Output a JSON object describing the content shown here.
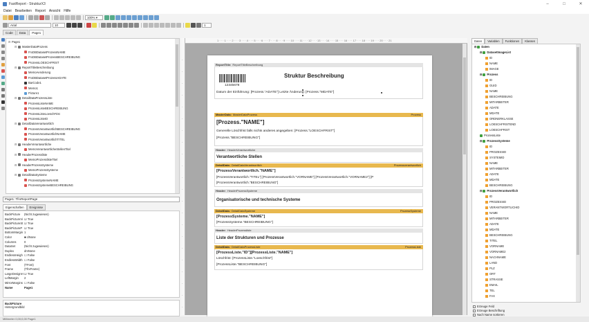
{
  "window": {
    "title": "FastReport - StrukturX3",
    "controls": [
      "–",
      "□",
      "✕"
    ]
  },
  "menu": [
    "Datei",
    "Bearbeiten",
    "Report",
    "Ansicht",
    "Hilfe"
  ],
  "toolbar": {
    "zoom": "100% ▾",
    "font_name": "Arial",
    "font_size": "10",
    "extra": "1"
  },
  "tabs": [
    "Code",
    "Data",
    "Page1"
  ],
  "tree": [
    {
      "t": "Page1",
      "lvl": 0,
      "ic": "page",
      "exp": "⊟"
    },
    {
      "t": "MasterDataProzess",
      "lvl": 1,
      "ic": "band",
      "exp": "⊟"
    },
    {
      "t": "FrxDBDatasetProzessNAME",
      "lvl": 2,
      "ic": "memo"
    },
    {
      "t": "FrxDBDatasetProzessBESCHREIBUNG",
      "lvl": 2,
      "ic": "memo"
    },
    {
      "t": "ProzessLOESCHFRIST",
      "lvl": 2,
      "ic": "memo"
    },
    {
      "t": "ReportTitleBeschreibung",
      "lvl": 1,
      "ic": "band",
      "exp": "⊟"
    },
    {
      "t": "MemoAenderung",
      "lvl": 2,
      "ic": "memo"
    },
    {
      "t": "FrxDBDatasetProzessADATE",
      "lvl": 2,
      "ic": "memo"
    },
    {
      "t": "BarCode1",
      "lvl": 2,
      "ic": "bar"
    },
    {
      "t": "Memo1",
      "lvl": 2,
      "ic": "memo"
    },
    {
      "t": "Picture1",
      "lvl": 2,
      "ic": "pic"
    },
    {
      "t": "DetailDataProzessListe",
      "lvl": 1,
      "ic": "band",
      "exp": "⊟"
    },
    {
      "t": "ProzessListeNAME",
      "lvl": 2,
      "ic": "memo"
    },
    {
      "t": "ProzessListeBESCHREIBUNG",
      "lvl": 2,
      "ic": "memo"
    },
    {
      "t": "ProzessListeLoeschFrist",
      "lvl": 2,
      "ic": "memo"
    },
    {
      "t": "ProzessListeID",
      "lvl": 2,
      "ic": "memo"
    },
    {
      "t": "DetailDataVerantwortlich",
      "lvl": 1,
      "ic": "band",
      "exp": "⊟"
    },
    {
      "t": "ProzessVerantwortlichBESCHREIBUNG",
      "lvl": 2,
      "ic": "memo"
    },
    {
      "t": "ProzessVerantwortlichNAME",
      "lvl": 2,
      "ic": "memo"
    },
    {
      "t": "ProzessVerantwortlichTITEL",
      "lvl": 2,
      "ic": "memo"
    },
    {
      "t": "HeaderVerantwortliche",
      "lvl": 1,
      "ic": "band",
      "exp": "⊟"
    },
    {
      "t": "MemoVerantwortlicheStellenTitel",
      "lvl": 2,
      "ic": "memo"
    },
    {
      "t": "HeaderProzessliste",
      "lvl": 1,
      "ic": "band",
      "exp": "⊟"
    },
    {
      "t": "MemoProzesslisteTitel",
      "lvl": 2,
      "ic": "memo"
    },
    {
      "t": "HeaderProzessSysteme",
      "lvl": 1,
      "ic": "band",
      "exp": "⊟"
    },
    {
      "t": "MemoProzessSysteme",
      "lvl": 2,
      "ic": "memo"
    },
    {
      "t": "DetailDataSysteme",
      "lvl": 1,
      "ic": "band",
      "exp": "⊟"
    },
    {
      "t": "ProzessSystemeNAME",
      "lvl": 2,
      "ic": "memo"
    },
    {
      "t": "ProzessSystemeBESCHREIBUNG",
      "lvl": 2,
      "ic": "memo"
    }
  ],
  "object_selector": "Page1: TfrxReportPage",
  "prop_tabs": [
    "Eigenschaften",
    "Ereignisse"
  ],
  "props": [
    [
      "BackPicture",
      "(Nicht zugewiesen)"
    ],
    [
      "BackPictureVi",
      "☑ True"
    ],
    [
      "BackPictureSt",
      "☑ True"
    ],
    [
      "BackPictureP",
      "☑ True"
    ],
    [
      "BottomMargin",
      "1"
    ],
    [
      "Color",
      "■ clNone"
    ],
    [
      "Columns",
      "0"
    ],
    [
      "DataSet",
      "(Nicht zugewiesen)"
    ],
    [
      "Duplex",
      "dmNone"
    ],
    [
      "EndlessHeigh",
      "☐ False"
    ],
    [
      "EndlessWidth",
      "☐ False"
    ],
    [
      "Font",
      "(TFont)"
    ],
    [
      "Frame",
      "(TfrxFrame)"
    ],
    [
      "LargeDesignH",
      "☑ True"
    ],
    [
      "LeftMargin",
      "2"
    ],
    [
      "MirrorMargins",
      "☐ False"
    ],
    [
      "Name",
      "Page1"
    ]
  ],
  "prop_desc": {
    "title": "BackPicture",
    "text": "Hintergrundbild"
  },
  "status": "Millimeter   0,00;0,00   Page1",
  "ruler_text": "1 · · · 1 · · · 2 · · · 3 · · · 4 · · · 5 · · · 6 · · · 7 · · · 8 · · · 9 · · · 10 · · · 11 · · · 12 · · · 13 · · · 14 · · · 15 · · · 16 · · · 17 · · · 18 · · · 19 · · · 20 · · · 21",
  "bands": {
    "title": {
      "kind": "ReportTitle:",
      "name": "ReportTitleBeschreibung",
      "heading": "Struktur Beschreibung",
      "barcode": "12345678",
      "dates": "Datum der Einführung: [Prozess.\"ADATE\"]  Letzte Änderung: [Prozess.\"MDATE\"]"
    },
    "master": {
      "kind": "MasterData:",
      "name": "MasterDataProzess",
      "right": "Prozess",
      "name_field": "[Prozess.\"NAME\"]",
      "loesch": "Generelle Löschfrist falls nichts anderes angegeben: [Prozess.\"LOESCHFRIST\"]",
      "beschr": "[Prozess.\"BESCHREIBUNG\"]"
    },
    "hdr_verant": {
      "kind": "Header:",
      "name": "HeaderVerantwortliche",
      "text": "Verantwortliche Stellen"
    },
    "det_verant": {
      "kind": "DetailData:",
      "name": "DetailDataVerantwortlich",
      "right": "Prozessverantwortlich",
      "name_field": "[ProzessVerantwortlich.\"NAME\"]",
      "line2": "[ProzessVerantwortlich.\"TITEL\"] [ProzessVerantwortlich.\"VORNAME\"] [ProzessVerantwortlich.\"VORNAME2\"] [P",
      "line3": "[ProzessVerantwortlich.\"BESCHREIBUNG\"]"
    },
    "hdr_sys": {
      "kind": "Header:",
      "name": "HeaderProzessSysteme",
      "text": "Organisatorische und technische Systeme"
    },
    "det_sys": {
      "kind": "DetailData:",
      "name": "DetailDataSysteme",
      "right": "ProzessSysteme",
      "name_field": "[ProzessSysteme.\"NAME\"]",
      "line2": "[ProzessSysteme.\"BESCHREIBUNG\"]"
    },
    "hdr_list": {
      "kind": "Header:",
      "name": "HeaderProzessliste",
      "text": "Liste der Strukturen und Prozesse"
    },
    "det_list": {
      "kind": "DetailData:",
      "name": "DetailDataProzessListe",
      "right": "ProzessListe",
      "name_field": "[ProzessListe.\"ID\"][ProzessListe.\"NAME\"]",
      "line2": "Löschfrist: [ProzessListe.\"Loeschfrist\"]",
      "line3": "[ProzessListe.\"BESCHREIBUNG\"]"
    }
  },
  "right_tabs": [
    "Daten",
    "Variablen",
    "Funktionen",
    "Klassen"
  ],
  "data_tree": [
    {
      "t": "Daten",
      "lvl": 0,
      "ic": "ds",
      "b": true,
      "exp": "⊟"
    },
    {
      "t": "DatasetImageList",
      "lvl": 1,
      "ic": "ds",
      "b": true,
      "exp": "⊟"
    },
    {
      "t": "ID",
      "lvl": 2,
      "ic": "fld"
    },
    {
      "t": "NAME",
      "lvl": 2,
      "ic": "fld"
    },
    {
      "t": "IMAGE",
      "lvl": 2,
      "ic": "fld"
    },
    {
      "t": "Prozess",
      "lvl": 1,
      "ic": "ds",
      "b": true,
      "exp": "⊟"
    },
    {
      "t": "ID",
      "lvl": 2,
      "ic": "fld"
    },
    {
      "t": "GUID",
      "lvl": 2,
      "ic": "fld"
    },
    {
      "t": "NAME",
      "lvl": 2,
      "ic": "fld"
    },
    {
      "t": "BESCHREIBUNG",
      "lvl": 2,
      "ic": "fld"
    },
    {
      "t": "MITARBEITER",
      "lvl": 2,
      "ic": "fld"
    },
    {
      "t": "ADATE",
      "lvl": 2,
      "ic": "fld"
    },
    {
      "t": "MDATE",
      "lvl": 2,
      "ic": "fld"
    },
    {
      "t": "ORDNERKLASSE",
      "lvl": 2,
      "ic": "fld"
    },
    {
      "t": "LOESCHFRISTEND",
      "lvl": 2,
      "ic": "fld"
    },
    {
      "t": "LOESCHFRIST",
      "lvl": 2,
      "ic": "fld"
    },
    {
      "t": "ProzessListe",
      "lvl": 1,
      "ic": "ds",
      "b": false
    },
    {
      "t": "ProzessSysteme",
      "lvl": 1,
      "ic": "ds",
      "b": true,
      "exp": "⊟"
    },
    {
      "t": "ID",
      "lvl": 2,
      "ic": "fld"
    },
    {
      "t": "PROZESSID",
      "lvl": 2,
      "ic": "fld"
    },
    {
      "t": "SYSTEMID",
      "lvl": 2,
      "ic": "fld"
    },
    {
      "t": "NAME",
      "lvl": 2,
      "ic": "fld"
    },
    {
      "t": "MITARBEITER",
      "lvl": 2,
      "ic": "fld"
    },
    {
      "t": "ADATE",
      "lvl": 2,
      "ic": "fld"
    },
    {
      "t": "MDATE",
      "lvl": 2,
      "ic": "fld"
    },
    {
      "t": "BESCHREIBUNG",
      "lvl": 2,
      "ic": "fld"
    },
    {
      "t": "ProzessVerantwortlich",
      "lvl": 1,
      "ic": "ds",
      "b": true,
      "exp": "⊟"
    },
    {
      "t": "ID",
      "lvl": 2,
      "ic": "fld"
    },
    {
      "t": "PROZESSID",
      "lvl": 2,
      "ic": "fld"
    },
    {
      "t": "VERANTWORTLICHID",
      "lvl": 2,
      "ic": "fld"
    },
    {
      "t": "NAME",
      "lvl": 2,
      "ic": "fld"
    },
    {
      "t": "MITARBEITER",
      "lvl": 2,
      "ic": "fld"
    },
    {
      "t": "ADATE",
      "lvl": 2,
      "ic": "fld"
    },
    {
      "t": "MDATE",
      "lvl": 2,
      "ic": "fld"
    },
    {
      "t": "BESCHREIBUNG",
      "lvl": 2,
      "ic": "fld"
    },
    {
      "t": "TITEL",
      "lvl": 2,
      "ic": "fld"
    },
    {
      "t": "VORNAME",
      "lvl": 2,
      "ic": "fld"
    },
    {
      "t": "VORNAME2",
      "lvl": 2,
      "ic": "fld"
    },
    {
      "t": "NACHNAME",
      "lvl": 2,
      "ic": "fld"
    },
    {
      "t": "LAND",
      "lvl": 2,
      "ic": "fld"
    },
    {
      "t": "PLZ",
      "lvl": 2,
      "ic": "fld"
    },
    {
      "t": "ORT",
      "lvl": 2,
      "ic": "fld"
    },
    {
      "t": "STRASSE",
      "lvl": 2,
      "ic": "fld"
    },
    {
      "t": "EMAIL",
      "lvl": 2,
      "ic": "fld"
    },
    {
      "t": "TEL",
      "lvl": 2,
      "ic": "fld"
    },
    {
      "t": "FAX",
      "lvl": 2,
      "ic": "fld"
    }
  ],
  "checks": [
    "Erzeuge Feld",
    "Erzeuge Beschriftung",
    "Nach Name sortieren"
  ]
}
